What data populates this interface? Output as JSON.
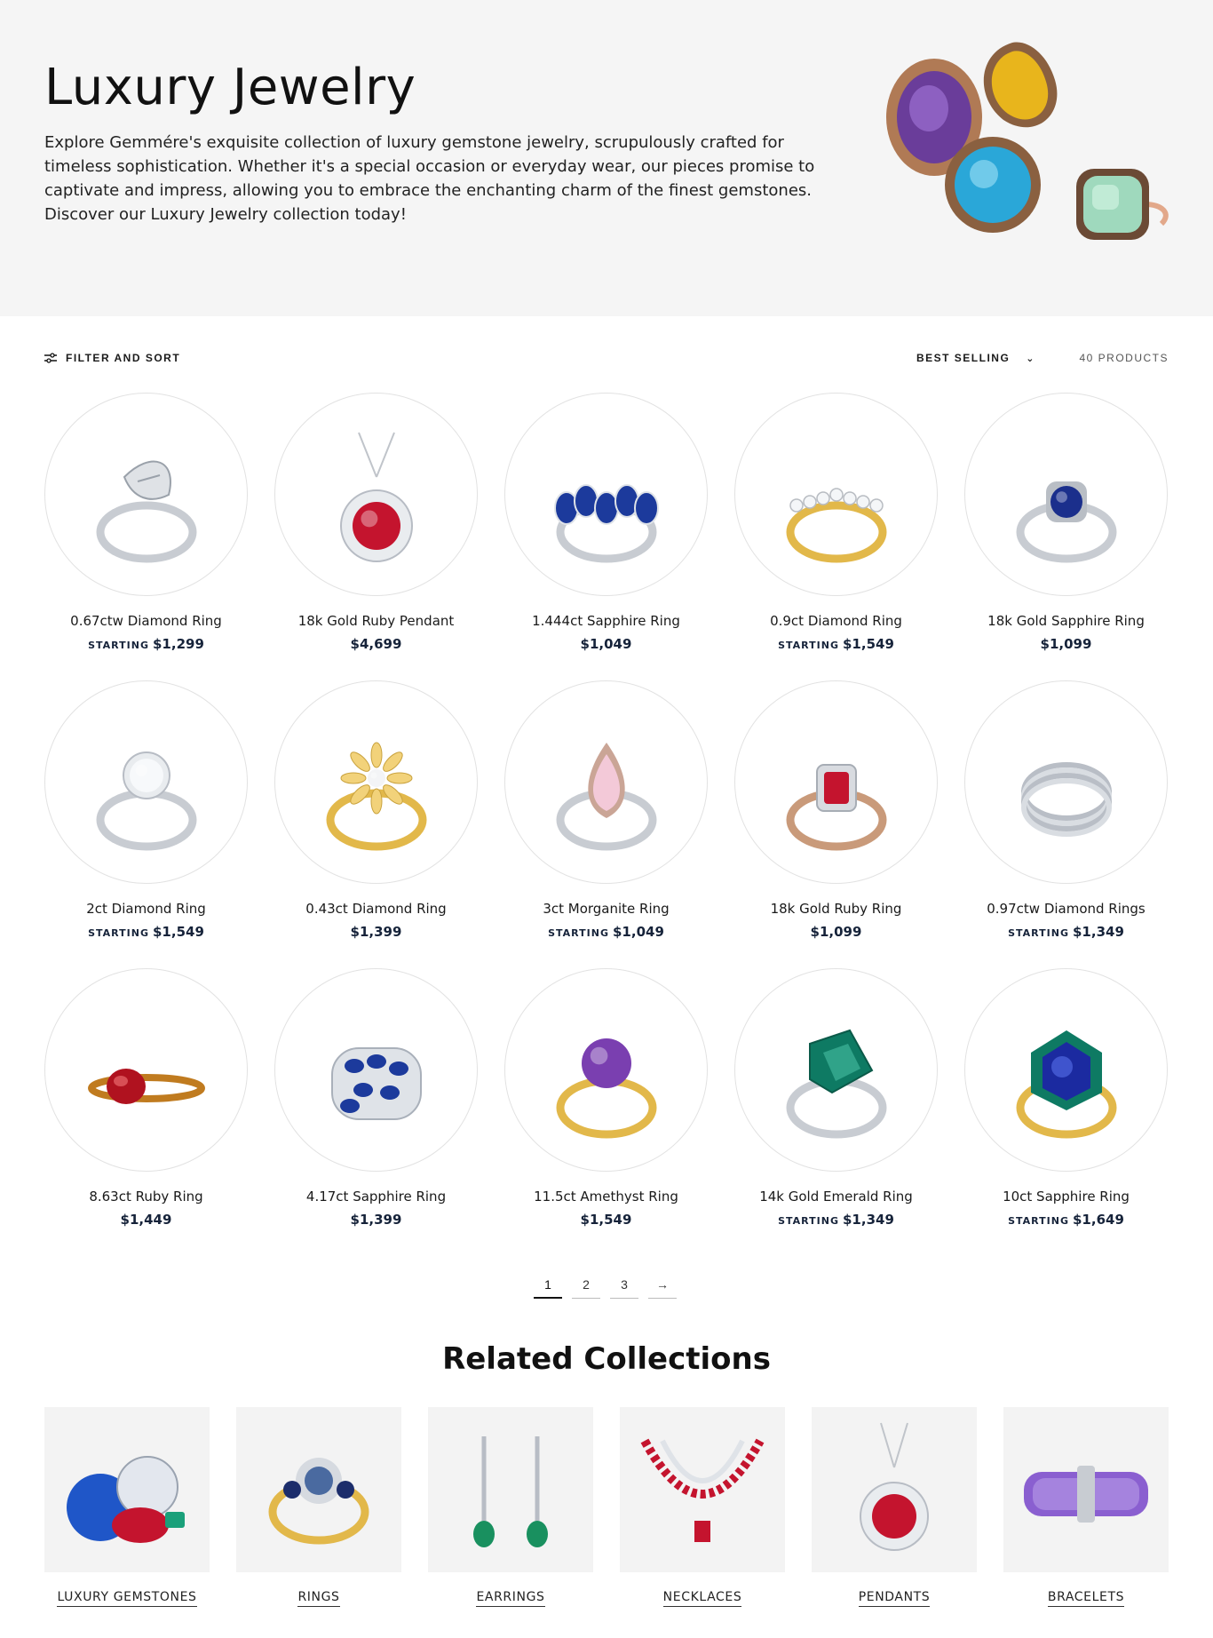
{
  "hero": {
    "title": "Luxury Jewelry",
    "description": "Explore Gemmére's exquisite collection of luxury gemstone jewelry, scrupulously crafted for timeless sophistication. Whether it's a special occasion or everyday wear, our pieces promise to captivate and impress, allowing you to embrace the enchanting charm of the finest gemstones. Discover our Luxury Jewelry collection today!"
  },
  "toolbar": {
    "filter_label": "FILTER AND SORT",
    "sort_label": "BEST SELLING",
    "count_label": "40 PRODUCTS"
  },
  "products": [
    {
      "name": "0.67ctw Diamond Ring",
      "prefix": "STARTING",
      "price": "$1,299"
    },
    {
      "name": "18k Gold Ruby Pendant",
      "prefix": "",
      "price": "$4,699"
    },
    {
      "name": "1.444ct Sapphire Ring",
      "prefix": "",
      "price": "$1,049"
    },
    {
      "name": "0.9ct Diamond Ring",
      "prefix": "STARTING",
      "price": "$1,549"
    },
    {
      "name": "18k Gold Sapphire Ring",
      "prefix": "",
      "price": "$1,099"
    },
    {
      "name": "2ct Diamond Ring",
      "prefix": "STARTING",
      "price": "$1,549"
    },
    {
      "name": "0.43ct Diamond Ring",
      "prefix": "",
      "price": "$1,399"
    },
    {
      "name": "3ct Morganite Ring",
      "prefix": "STARTING",
      "price": "$1,049"
    },
    {
      "name": "18k Gold Ruby Ring",
      "prefix": "",
      "price": "$1,099"
    },
    {
      "name": "0.97ctw Diamond Rings",
      "prefix": "STARTING",
      "price": "$1,349"
    },
    {
      "name": "8.63ct Ruby Ring",
      "prefix": "",
      "price": "$1,449"
    },
    {
      "name": "4.17ct Sapphire Ring",
      "prefix": "",
      "price": "$1,399"
    },
    {
      "name": "11.5ct Amethyst Ring",
      "prefix": "",
      "price": "$1,549"
    },
    {
      "name": "14k Gold Emerald Ring",
      "prefix": "STARTING",
      "price": "$1,349"
    },
    {
      "name": "10ct Sapphire Ring",
      "prefix": "STARTING",
      "price": "$1,649"
    }
  ],
  "pagination": {
    "pages": [
      "1",
      "2",
      "3"
    ],
    "next": "→",
    "current": "1"
  },
  "related": {
    "title": "Related Collections",
    "items": [
      "LUXURY GEMSTONES",
      "RINGS",
      "EARRINGS",
      "NECKLACES",
      "PENDANTS",
      "BRACELETS"
    ]
  },
  "colors": {
    "hero_bg": "#f5f5f5",
    "price_text": "#16233a",
    "ruby": "#c4142e",
    "sapphire": "#1c3a9c",
    "emerald": "#0e7a63",
    "amethyst": "#7a3fb0",
    "gold": "#e2b84a",
    "silver": "#c8ccd2"
  }
}
